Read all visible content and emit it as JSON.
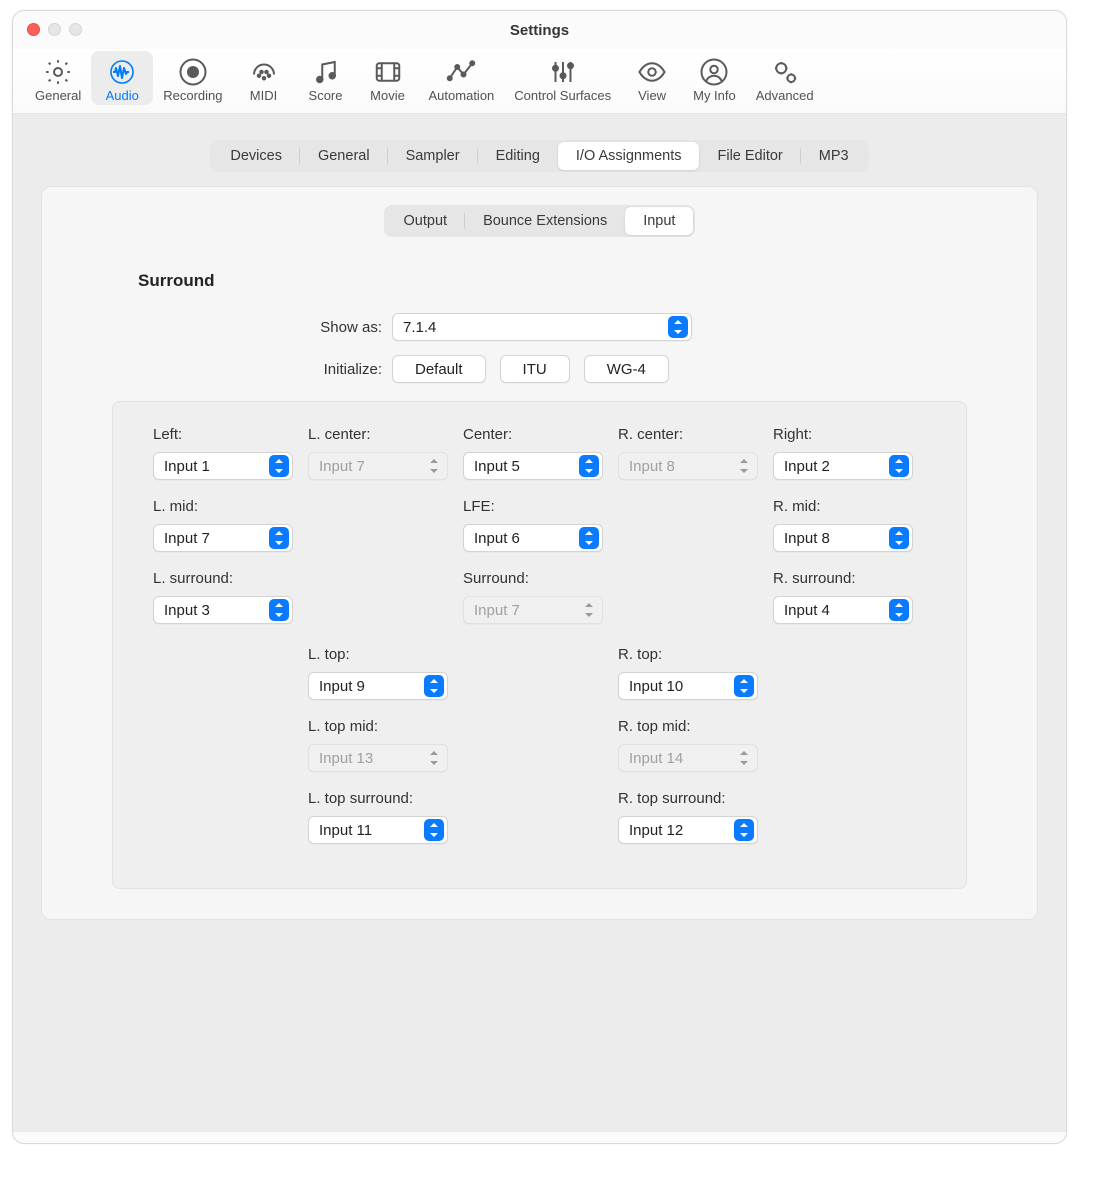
{
  "window": {
    "title": "Settings"
  },
  "toolbar": {
    "items": [
      {
        "label": "General"
      },
      {
        "label": "Audio"
      },
      {
        "label": "Recording"
      },
      {
        "label": "MIDI"
      },
      {
        "label": "Score"
      },
      {
        "label": "Movie"
      },
      {
        "label": "Automation"
      },
      {
        "label": "Control Surfaces"
      },
      {
        "label": "View"
      },
      {
        "label": "My Info"
      },
      {
        "label": "Advanced"
      }
    ]
  },
  "tabs1": {
    "items": [
      "Devices",
      "General",
      "Sampler",
      "Editing",
      "I/O Assignments",
      "File Editor",
      "MP3"
    ],
    "active": "I/O Assignments"
  },
  "tabs2": {
    "items": [
      "Output",
      "Bounce Extensions",
      "Input"
    ],
    "active": "Input"
  },
  "section": {
    "title": "Surround",
    "show_as_label": "Show as:",
    "show_as_value": "7.1.4",
    "initialize_label": "Initialize:",
    "init_buttons": [
      "Default",
      "ITU",
      "WG-4"
    ]
  },
  "channels": {
    "left": {
      "label": "Left:",
      "value": "Input 1",
      "disabled": false
    },
    "l_center": {
      "label": "L. center:",
      "value": "Input 7",
      "disabled": true
    },
    "center": {
      "label": "Center:",
      "value": "Input 5",
      "disabled": false
    },
    "r_center": {
      "label": "R. center:",
      "value": "Input 8",
      "disabled": true
    },
    "right": {
      "label": "Right:",
      "value": "Input 2",
      "disabled": false
    },
    "l_mid": {
      "label": "L. mid:",
      "value": "Input 7",
      "disabled": false
    },
    "lfe": {
      "label": "LFE:",
      "value": "Input 6",
      "disabled": false
    },
    "r_mid": {
      "label": "R. mid:",
      "value": "Input 8",
      "disabled": false
    },
    "l_surround": {
      "label": "L. surround:",
      "value": "Input 3",
      "disabled": false
    },
    "surround": {
      "label": "Surround:",
      "value": "Input 7",
      "disabled": true
    },
    "r_surround": {
      "label": "R. surround:",
      "value": "Input 4",
      "disabled": false
    },
    "l_top": {
      "label": "L. top:",
      "value": "Input 9",
      "disabled": false
    },
    "r_top": {
      "label": "R. top:",
      "value": "Input 10",
      "disabled": false
    },
    "l_top_mid": {
      "label": "L. top mid:",
      "value": "Input 13",
      "disabled": true
    },
    "r_top_mid": {
      "label": "R. top mid:",
      "value": "Input 14",
      "disabled": true
    },
    "l_top_surr": {
      "label": "L. top surround:",
      "value": "Input 11",
      "disabled": false
    },
    "r_top_surr": {
      "label": "R. top surround:",
      "value": "Input 12",
      "disabled": false
    }
  }
}
